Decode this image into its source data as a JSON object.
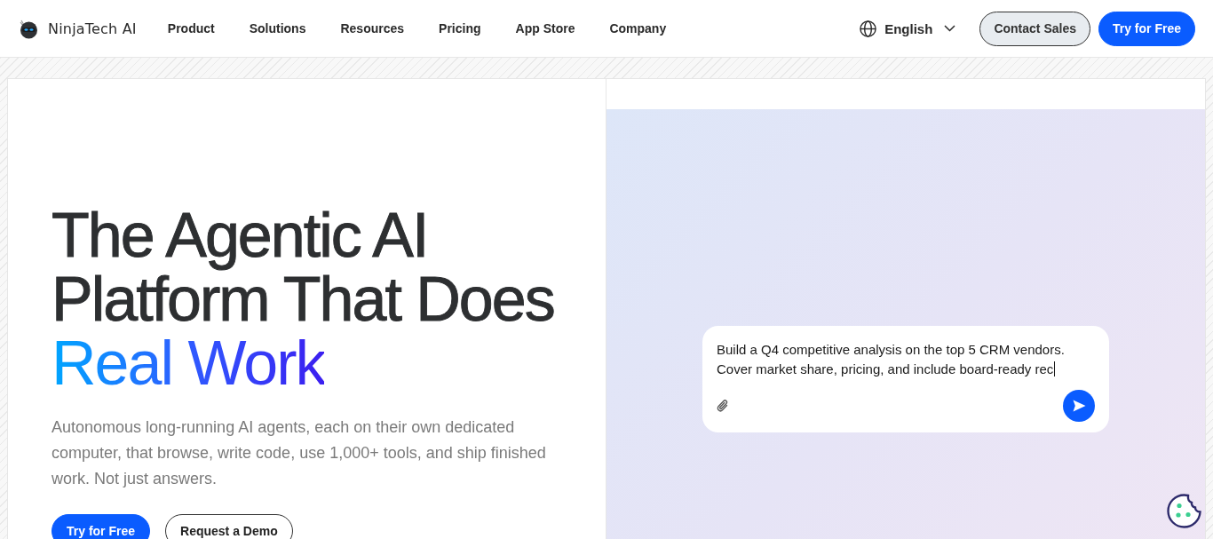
{
  "header": {
    "logo": "NinjaTech AI",
    "nav": [
      "Product",
      "Solutions",
      "Resources",
      "Pricing",
      "App Store",
      "Company"
    ],
    "language": "English",
    "actions": [
      {
        "label": "Contact Sales",
        "kind": "secondary"
      },
      {
        "label": "Try for Free",
        "kind": "primary"
      }
    ]
  },
  "hero": {
    "title_lines": [
      "The Agentic AI",
      "Platform That Does"
    ],
    "title_highlight": "Real Work",
    "description": "Autonomous long-running AI agents, each on their own dedicated computer, that browse, write code, use 1,000+ tools, and ship finished work. Not just answers.",
    "actions": [
      {
        "label": "Try for Free",
        "kind": "primary"
      },
      {
        "label": "Request a Demo",
        "kind": "outline"
      }
    ]
  },
  "prompt": {
    "value": "Build a Q4 competitive analysis on the top 5 CRM vendors. Cover market share, pricing, and include board-ready rec",
    "focused": true
  }
}
